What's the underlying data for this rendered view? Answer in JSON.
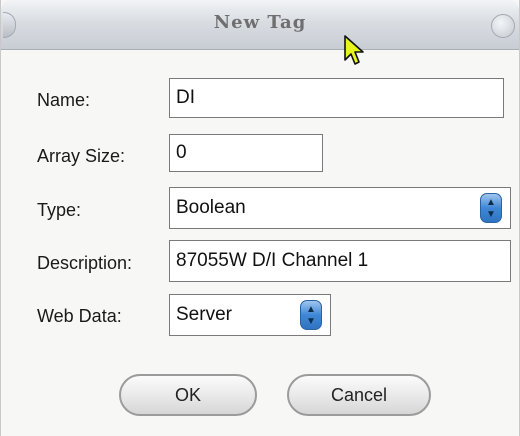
{
  "window": {
    "title": "New Tag"
  },
  "form": {
    "name": {
      "label": "Name:",
      "value": "DI"
    },
    "array_size": {
      "label": "Array Size:",
      "value": "0"
    },
    "type": {
      "label": "Type:",
      "selected": "Boolean"
    },
    "description": {
      "label": "Description:",
      "value": "87055W D/I Channel 1"
    },
    "web_data": {
      "label": "Web Data:",
      "selected": "Server"
    }
  },
  "buttons": {
    "ok_label": "OK",
    "cancel_label": "Cancel"
  },
  "icons": {
    "stepper": "up-down-arrows-icon",
    "cursor": "mouse-pointer-icon"
  },
  "colors": {
    "stepper_blue": "#3f87d6",
    "title_text": "#6f6f6f",
    "cursor_fill": "#e6f51a"
  }
}
